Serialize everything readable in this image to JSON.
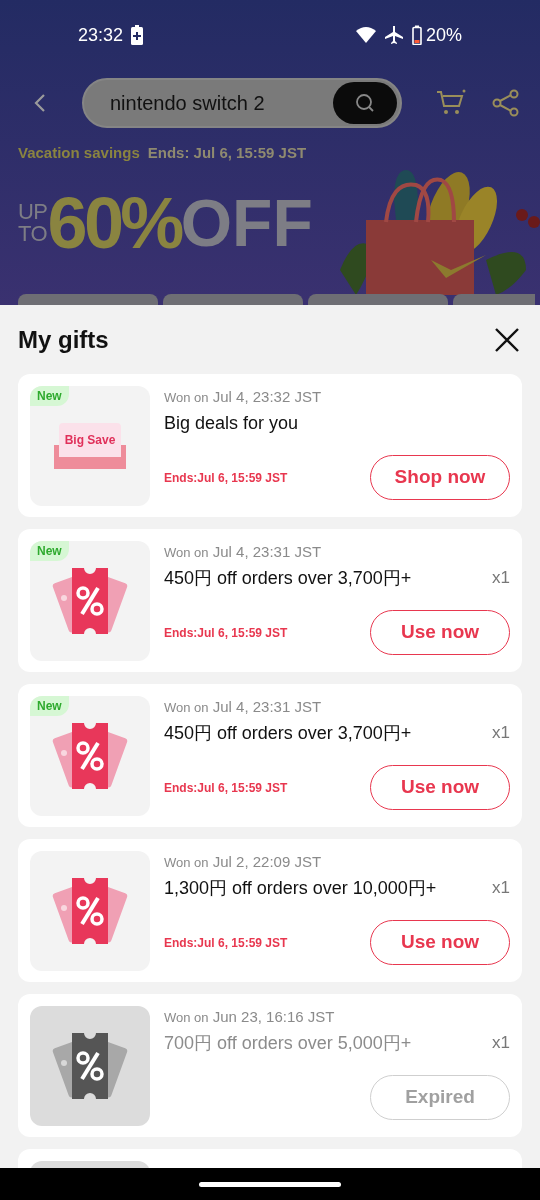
{
  "status_bar": {
    "time": "23:32",
    "battery": "20%"
  },
  "header": {
    "search_value": "nintendo switch 2"
  },
  "banner": {
    "campaign": "Vacation savings",
    "ends": "Ends: Jul 6, 15:59 JST",
    "up": "UP",
    "to": "TO",
    "percent": "60%",
    "off": "OFF"
  },
  "sheet": {
    "title": "My gifts",
    "gifts": [
      {
        "kind": "envelope",
        "image_text": "Big Save",
        "badge": "New",
        "won_prefix": "Won on",
        "won_date": "Jul 4, 23:32 JST",
        "title": "Big deals for you",
        "ends": "Ends:Jul 6, 15:59 JST",
        "button": "Shop now",
        "expired": false
      },
      {
        "kind": "coupon",
        "badge": "New",
        "won_prefix": "Won on",
        "won_date": "Jul 4, 23:31 JST",
        "title": "450円 off orders over 3,700円+",
        "quantity": "x1",
        "ends": "Ends:Jul 6, 15:59 JST",
        "button": "Use now",
        "expired": false
      },
      {
        "kind": "coupon",
        "badge": "New",
        "won_prefix": "Won on",
        "won_date": "Jul 4, 23:31 JST",
        "title": "450円 off orders over 3,700円+",
        "quantity": "x1",
        "ends": "Ends:Jul 6, 15:59 JST",
        "button": "Use now",
        "expired": false
      },
      {
        "kind": "coupon",
        "won_prefix": "Won on",
        "won_date": "Jul 2, 22:09 JST",
        "title": "1,300円 off orders over 10,000円+",
        "quantity": "x1",
        "ends": "Ends:Jul 6, 15:59 JST",
        "button": "Use now",
        "expired": false
      },
      {
        "kind": "coupon",
        "won_prefix": "Won on",
        "won_date": "Jun 23, 16:16 JST",
        "title": "700円 off orders over 5,000円+",
        "quantity": "x1",
        "button": "Expired",
        "expired": true
      }
    ]
  }
}
